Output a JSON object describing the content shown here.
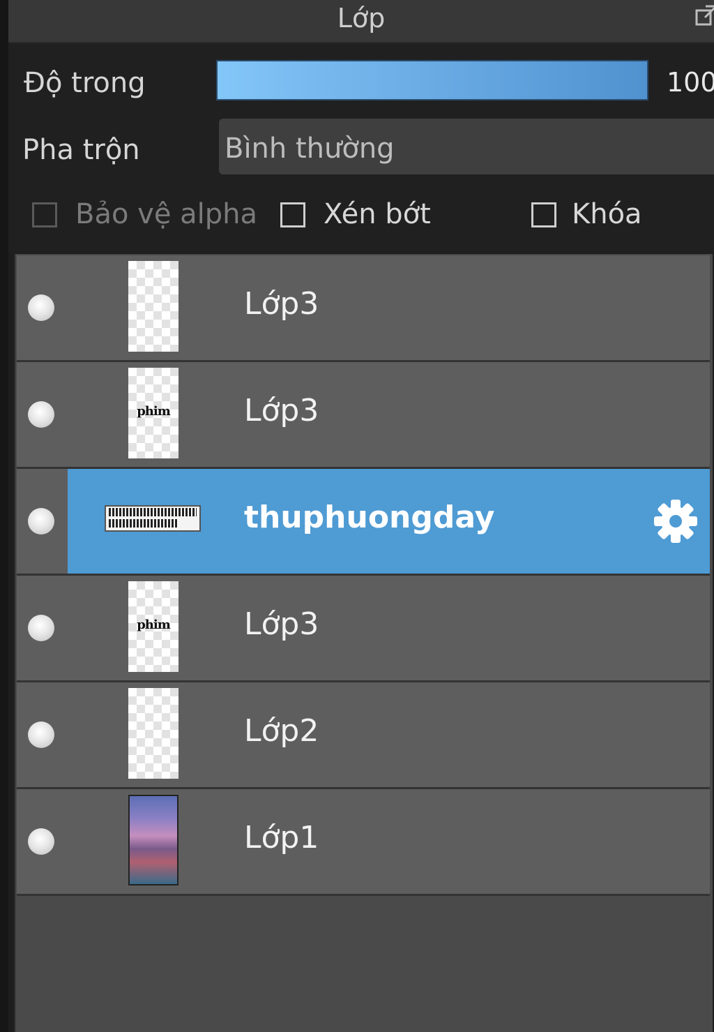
{
  "panel": {
    "title": "Lớp"
  },
  "opacity": {
    "label": "Độ trong",
    "value": "100",
    "fill_fraction": 1.0
  },
  "blend": {
    "label": "Pha trộn",
    "value": "Bình thường"
  },
  "checkboxes": [
    {
      "label": "Bảo vệ alpha",
      "checked": false,
      "enabled": false
    },
    {
      "label": "Xén bớt",
      "checked": false,
      "enabled": true
    },
    {
      "label": "Khóa",
      "checked": false,
      "enabled": true
    }
  ],
  "layers": [
    {
      "name": "Lớp3",
      "thumb": "transparent",
      "selected": false
    },
    {
      "name": "Lớp3",
      "thumb": "text-phim",
      "thumb_text": "phim",
      "selected": false
    },
    {
      "name": "thuphuongday",
      "thumb": "text-wide",
      "selected": true
    },
    {
      "name": "Lớp3",
      "thumb": "text-phim",
      "thumb_text": "phim",
      "selected": false
    },
    {
      "name": "Lớp2",
      "thumb": "transparent",
      "selected": false
    },
    {
      "name": "Lớp1",
      "thumb": "photo",
      "selected": false
    }
  ],
  "colors": {
    "accent": "#4f9bd4",
    "row_bg": "#5e5e5e",
    "panel_bg": "#202020"
  }
}
